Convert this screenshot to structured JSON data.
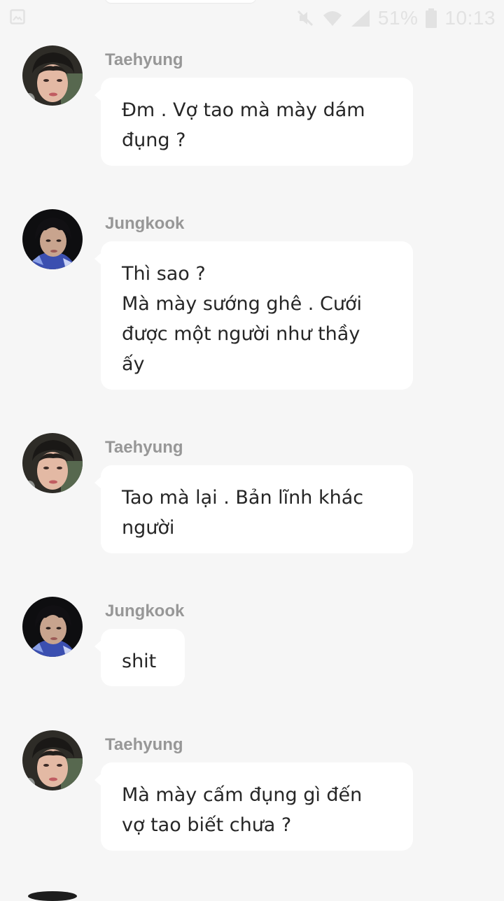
{
  "status_bar": {
    "battery_percent": "51%",
    "time": "10:13",
    "icons": [
      "gallery-icon",
      "mute-icon",
      "wifi-icon",
      "signal-icon",
      "battery-icon"
    ]
  },
  "colors": {
    "background": "#f6f6f6",
    "bubble": "#ffffff",
    "sender_name": "#979797",
    "message_text": "#262626"
  },
  "messages": [
    {
      "sender": "Taehyung",
      "avatar": "taehyung-avatar",
      "text": "Đm . Vợ tao mà mày dám\nđụng ?"
    },
    {
      "sender": "Jungkook",
      "avatar": "jungkook-avatar",
      "text": "Thì sao ?\nMà mày sướng ghê . Cưới\nđược một người như thầy\nấy"
    },
    {
      "sender": "Taehyung",
      "avatar": "taehyung-avatar",
      "text": "Tao mà lại . Bản lĩnh khác\nngười"
    },
    {
      "sender": "Jungkook",
      "avatar": "jungkook-avatar",
      "text": "shit"
    },
    {
      "sender": "Taehyung",
      "avatar": "taehyung-avatar",
      "text": "Mà mày cấm đụng gì đến\nvợ tao biết chưa ?"
    }
  ]
}
